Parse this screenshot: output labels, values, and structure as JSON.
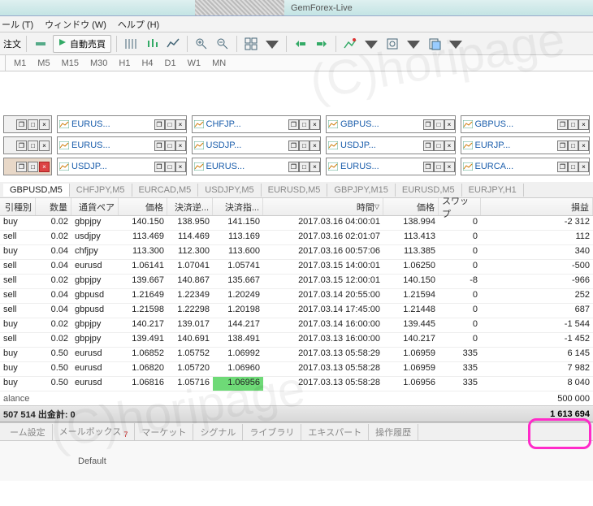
{
  "title": "GemForex-Live",
  "menus": [
    "ール (T)",
    "ウィンドウ (W)",
    "ヘルプ (H)"
  ],
  "toolbar": {
    "order_label": "注文",
    "auto_label": "自動売買"
  },
  "timeframes": [
    "M1",
    "M5",
    "M15",
    "M30",
    "H1",
    "H4",
    "D1",
    "W1",
    "MN"
  ],
  "mdi": {
    "rows": [
      [
        "EURUS...",
        "CHFJP...",
        "GBPUS...",
        "GBPUS..."
      ],
      [
        "EURUS...",
        "USDJP...",
        "USDJP...",
        "EURJP..."
      ],
      [
        "USDJP...",
        "EURUS...",
        "EURUS...",
        "EURCA..."
      ]
    ],
    "selected_row": 2
  },
  "chart_tabs": [
    "GBPUSD,M5",
    "CHFJPY,M5",
    "EURCAD,M5",
    "USDJPY,M5",
    "EURUSD,M5",
    "GBPJPY,M15",
    "EURUSD,M5",
    "EURJPY,H1"
  ],
  "chart_tab_active": 0,
  "cols": [
    "引種別",
    "数量",
    "通貨ペア",
    "価格",
    "決済逆...",
    "決済指...",
    "時間",
    "価格",
    "スワップ",
    "損益"
  ],
  "rows": [
    [
      "buy",
      "0.02",
      "gbpjpy",
      "140.150",
      "138.950",
      "141.150",
      "2017.03.16 04:00:01",
      "138.994",
      "0",
      "-2 312"
    ],
    [
      "sell",
      "0.02",
      "usdjpy",
      "113.469",
      "114.469",
      "113.169",
      "2017.03.16 02:01:07",
      "113.413",
      "0",
      "112"
    ],
    [
      "buy",
      "0.04",
      "chfjpy",
      "113.300",
      "112.300",
      "113.600",
      "2017.03.16 00:57:06",
      "113.385",
      "0",
      "340"
    ],
    [
      "sell",
      "0.04",
      "eurusd",
      "1.06141",
      "1.07041",
      "1.05741",
      "2017.03.15 14:00:01",
      "1.06250",
      "0",
      "-500"
    ],
    [
      "sell",
      "0.02",
      "gbpjpy",
      "139.667",
      "140.867",
      "135.667",
      "2017.03.15 12:00:01",
      "140.150",
      "-8",
      "-966"
    ],
    [
      "sell",
      "0.04",
      "gbpusd",
      "1.21649",
      "1.22349",
      "1.20249",
      "2017.03.14 20:55:00",
      "1.21594",
      "0",
      "252"
    ],
    [
      "sell",
      "0.04",
      "gbpusd",
      "1.21598",
      "1.22298",
      "1.20198",
      "2017.03.14 17:45:00",
      "1.21448",
      "0",
      "687"
    ],
    [
      "buy",
      "0.02",
      "gbpjpy",
      "140.217",
      "139.017",
      "144.217",
      "2017.03.14 16:00:00",
      "139.445",
      "0",
      "-1 544"
    ],
    [
      "sell",
      "0.02",
      "gbpjpy",
      "139.491",
      "140.691",
      "138.491",
      "2017.03.13 16:00:00",
      "140.217",
      "0",
      "-1 452"
    ],
    [
      "buy",
      "0.50",
      "eurusd",
      "1.06852",
      "1.05752",
      "1.06992",
      "2017.03.13 05:58:29",
      "1.06959",
      "335",
      "6 145"
    ],
    [
      "buy",
      "0.50",
      "eurusd",
      "1.06820",
      "1.05720",
      "1.06960",
      "2017.03.13 05:58:28",
      "1.06959",
      "335",
      "7 982"
    ],
    [
      "buy",
      "0.50",
      "eurusd",
      "1.06816",
      "1.05716",
      "1.06956",
      "2017.03.13 05:58:28",
      "1.06956",
      "335",
      "8 040"
    ]
  ],
  "row_highlight": {
    "r": 11,
    "c": 5
  },
  "balance": {
    "label": "alance",
    "value": "500 000"
  },
  "summary": {
    "text": "507 514  出金計: 0",
    "value": "1 613 694"
  },
  "bottom_tabs": [
    "ーム設定",
    "メールボックス",
    "マーケット",
    "シグナル",
    "ライブラリ",
    "エキスパート",
    "操作履歴"
  ],
  "mailbox_badge": "7",
  "status": "Default",
  "watermarks": [
    "(C)horipage",
    "(C)horipage"
  ]
}
